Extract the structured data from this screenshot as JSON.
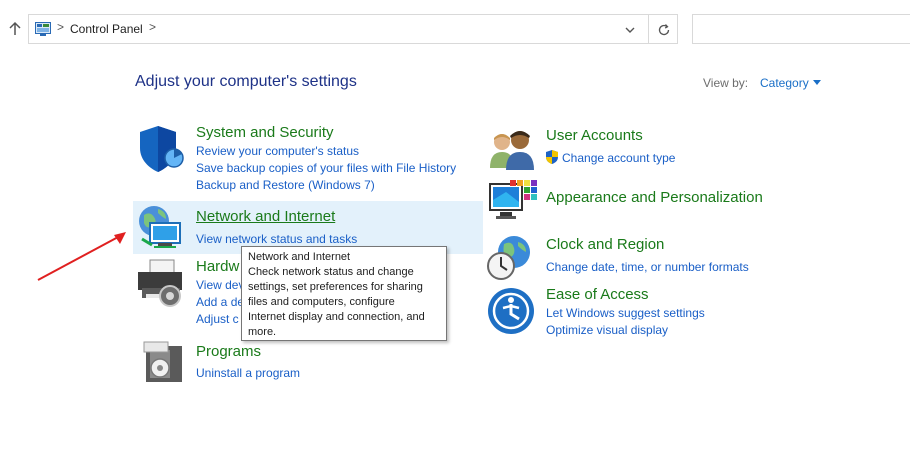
{
  "address": {
    "location": "Control Panel",
    "separator": ">"
  },
  "heading": "Adjust your computer's settings",
  "view_by": {
    "label": "View by:",
    "value": "Category"
  },
  "categories": {
    "system_security": {
      "title": "System and Security",
      "links": [
        "Review your computer's status",
        "Save backup copies of your files with File History",
        "Backup and Restore (Windows 7)"
      ]
    },
    "network_internet": {
      "title": "Network and Internet",
      "links": [
        "View network status and tasks"
      ]
    },
    "hardware_sound": {
      "title": "Hardw",
      "links": [
        "View dev",
        "Add a de",
        "Adjust c"
      ]
    },
    "programs": {
      "title": "Programs",
      "links": [
        "Uninstall a program"
      ]
    },
    "user_accounts": {
      "title": "User Accounts",
      "links": [
        "Change account type"
      ]
    },
    "appearance": {
      "title": "Appearance and Personalization"
    },
    "clock_region": {
      "title": "Clock and Region",
      "links": [
        "Change date, time, or number formats"
      ]
    },
    "ease_access": {
      "title": "Ease of Access",
      "links": [
        "Let Windows suggest settings",
        "Optimize visual display"
      ]
    }
  },
  "tooltip": {
    "lines": [
      "Network and Internet",
      "Check network status and change",
      "settings, set preferences for sharing",
      "files and computers, configure",
      "Internet display and connection, and",
      "more."
    ]
  },
  "colors": {
    "heading": "#1e3287",
    "category_title": "#1a7a1a",
    "link": "#1a5fc7",
    "hover_bg": "#e3f1fb",
    "arrow": "#e02020"
  },
  "icons": {
    "up": "up-arrow-icon",
    "control_panel": "control-panel-icon",
    "dropdown": "chevron-down-icon",
    "refresh": "refresh-icon",
    "shield": "shield-icon",
    "globe": "globe-network-icon",
    "printer": "printer-icon",
    "programs": "programs-icon",
    "users": "users-icon",
    "monitor": "monitor-palette-icon",
    "clock": "clock-globe-icon",
    "ease": "ease-of-access-icon",
    "uac": "uac-shield-icon"
  }
}
